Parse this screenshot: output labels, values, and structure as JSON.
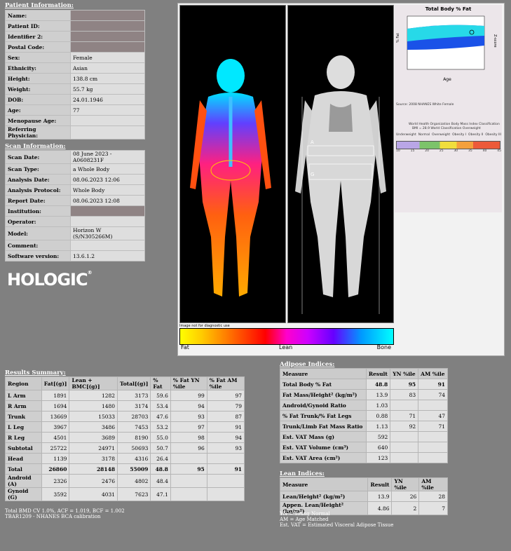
{
  "patient": {
    "title": "Patient Information:",
    "rows": [
      {
        "label": "Name:",
        "value": "",
        "masked": true
      },
      {
        "label": "Patient ID:",
        "value": "",
        "masked": true
      },
      {
        "label": "Identifier 2:",
        "value": "",
        "masked": true
      },
      {
        "label": "Postal Code:",
        "value": "",
        "masked": true
      },
      {
        "label": "Sex:",
        "value": "Female"
      },
      {
        "label": "Ethnicity:",
        "value": "Asian"
      },
      {
        "label": "Height:",
        "value": "138.8 cm"
      },
      {
        "label": "Weight:",
        "value": "55.7 kg"
      },
      {
        "label": "DOB:",
        "value": "24.01.1946"
      },
      {
        "label": "Age:",
        "value": "77"
      },
      {
        "label": "Menopause Age:",
        "value": ""
      },
      {
        "label": "Referring Physician:",
        "value": ""
      }
    ]
  },
  "scan": {
    "title": "Scan Information:",
    "rows": [
      {
        "label": "Scan Date:",
        "value": "08 June 2023 - A0608231F"
      },
      {
        "label": "Scan Type:",
        "value": "a Whole Body"
      },
      {
        "label": "Analysis Date:",
        "value": "08.06.2023 12:06"
      },
      {
        "label": "Analysis Protocol:",
        "value": "Whole Body"
      },
      {
        "label": "Report Date:",
        "value": "08.06.2023 12:08"
      },
      {
        "label": "Institution:",
        "value": "",
        "masked": true
      },
      {
        "label": "Operator:",
        "value": ""
      },
      {
        "label": "Model:",
        "value": "Horizon W (S/N305266M)"
      },
      {
        "label": "Comment:",
        "value": ""
      },
      {
        "label": "Software version:",
        "value": "13.6.1.2"
      }
    ]
  },
  "logo": {
    "text": "HOLOGIC",
    "mark": "®"
  },
  "colorbar": {
    "note": "Image not for diagnostic use",
    "labels": [
      "Fat",
      "Lean",
      "Bone"
    ]
  },
  "graph": {
    "title": "Total Body % Fat",
    "xlabel": "Age",
    "ylabel": "% Fat",
    "yright": "Z-score",
    "source": "Source: 2008 NHANES White Female",
    "who_note": "World Health Organization Body Mass Index Classification",
    "bmi_line": "BMI = 28.9 World Classification Overweight",
    "bmi_categories": [
      "Underweight",
      "Normal",
      "Overweight",
      "Obesity I",
      "Obesity II",
      "Obesity III"
    ],
    "bmi_ticks": [
      "10",
      "15",
      "20",
      "25",
      "30",
      "35",
      "40",
      "45"
    ]
  },
  "results": {
    "title": "Results Summary:",
    "headers": [
      "Region",
      "Fat[(g)]",
      "Lean + BMC[(g)]",
      "Total[(g)]",
      "% Fat",
      "% Fat YN %ile",
      "% Fat AM %ile"
    ],
    "rows": [
      [
        "L Arm",
        "1891",
        "1282",
        "3173",
        "59.6",
        "99",
        "97"
      ],
      [
        "R Arm",
        "1694",
        "1480",
        "3174",
        "53.4",
        "94",
        "79"
      ],
      [
        "Trunk",
        "13669",
        "15033",
        "28703",
        "47.6",
        "93",
        "87"
      ],
      [
        "L Leg",
        "3967",
        "3486",
        "7453",
        "53.2",
        "97",
        "91"
      ],
      [
        "R Leg",
        "4501",
        "3689",
        "8190",
        "55.0",
        "98",
        "94"
      ],
      [
        "Subtotal",
        "25722",
        "24971",
        "50693",
        "50.7",
        "96",
        "93"
      ],
      [
        "Head",
        "1139",
        "3178",
        "4316",
        "26.4",
        "",
        ""
      ],
      [
        "Total",
        "26860",
        "28148",
        "55009",
        "48.8",
        "95",
        "91"
      ],
      [
        "Android (A)",
        "2326",
        "2476",
        "4802",
        "48.4",
        "",
        ""
      ],
      [
        "Gynoid (G)",
        "3592",
        "4031",
        "7623",
        "47.1",
        "",
        ""
      ]
    ],
    "notes": [
      "Total BMD CV 1.0%, ACF = 1.019, BCF = 1.002",
      "TBAR1209 - NHANES BCA calibration"
    ]
  },
  "adipose": {
    "title": "Adipose Indices:",
    "headers": [
      "Measure",
      "Result",
      "YN %ile",
      "AM %ile"
    ],
    "rows": [
      [
        "Total Body % Fat",
        "48.8",
        "95",
        "91"
      ],
      [
        "Fat Mass/Height² (kg/m²)",
        "13.9",
        "83",
        "74"
      ],
      [
        "Android/Gynoid Ratio",
        "1.03",
        "",
        ""
      ],
      [
        "% Fat Trunk/% Fat Legs",
        "0.88",
        "71",
        "47"
      ],
      [
        "Trunk/Limb Fat Mass Ratio",
        "1.13",
        "92",
        "71"
      ],
      [
        "Est. VAT Mass (g)",
        "592",
        "",
        ""
      ],
      [
        "Est. VAT Volume (cm³)",
        "640",
        "",
        ""
      ],
      [
        "Est. VAT Area (cm²)",
        "123",
        "",
        ""
      ]
    ]
  },
  "lean": {
    "title": "Lean Indices:",
    "headers": [
      "Measure",
      "Result",
      "YN %ile",
      "AM %ile"
    ],
    "rows": [
      [
        "Lean/Height² (kg/m²)",
        "13.9",
        "26",
        "28"
      ],
      [
        "Appen. Lean/Height² (kg/m²)",
        "4.86",
        "2",
        "7"
      ]
    ],
    "notes": [
      "YN = Young Normal",
      "AM = Age Matched",
      "Est. VAT = Estimated Visceral Adipose Tissue"
    ]
  }
}
